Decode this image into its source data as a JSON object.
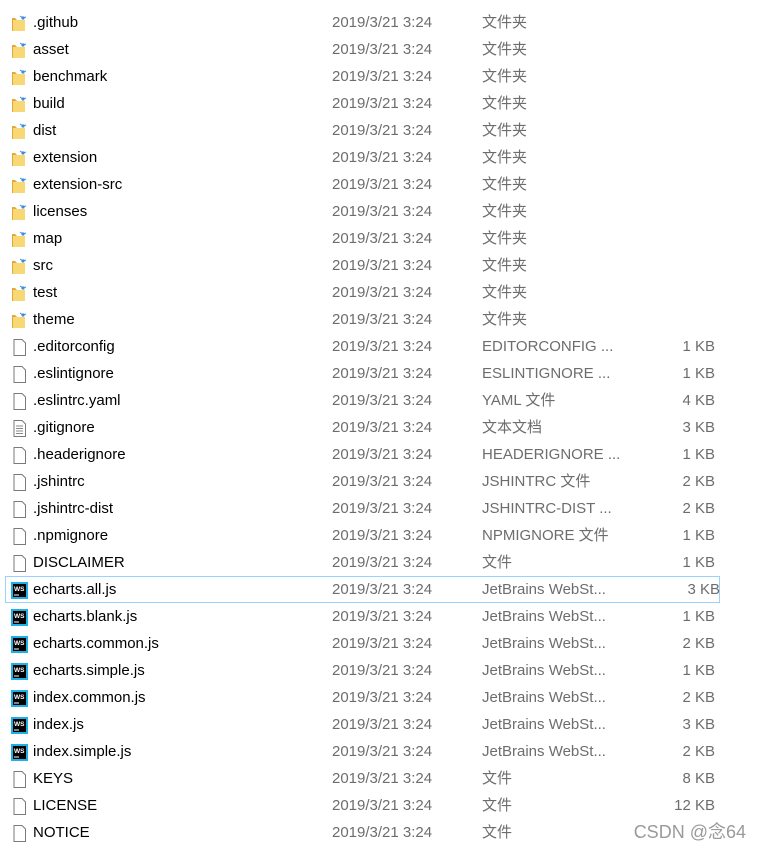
{
  "files": [
    {
      "name": ".github",
      "date": "2019/3/21 3:24",
      "type": "文件夹",
      "size": "",
      "icon": "folder-icon"
    },
    {
      "name": "asset",
      "date": "2019/3/21 3:24",
      "type": "文件夹",
      "size": "",
      "icon": "folder-icon"
    },
    {
      "name": "benchmark",
      "date": "2019/3/21 3:24",
      "type": "文件夹",
      "size": "",
      "icon": "folder-icon"
    },
    {
      "name": "build",
      "date": "2019/3/21 3:24",
      "type": "文件夹",
      "size": "",
      "icon": "folder-icon"
    },
    {
      "name": "dist",
      "date": "2019/3/21 3:24",
      "type": "文件夹",
      "size": "",
      "icon": "folder-icon"
    },
    {
      "name": "extension",
      "date": "2019/3/21 3:24",
      "type": "文件夹",
      "size": "",
      "icon": "folder-icon"
    },
    {
      "name": "extension-src",
      "date": "2019/3/21 3:24",
      "type": "文件夹",
      "size": "",
      "icon": "folder-icon"
    },
    {
      "name": "licenses",
      "date": "2019/3/21 3:24",
      "type": "文件夹",
      "size": "",
      "icon": "folder-icon"
    },
    {
      "name": "map",
      "date": "2019/3/21 3:24",
      "type": "文件夹",
      "size": "",
      "icon": "folder-icon"
    },
    {
      "name": "src",
      "date": "2019/3/21 3:24",
      "type": "文件夹",
      "size": "",
      "icon": "folder-icon"
    },
    {
      "name": "test",
      "date": "2019/3/21 3:24",
      "type": "文件夹",
      "size": "",
      "icon": "folder-icon"
    },
    {
      "name": "theme",
      "date": "2019/3/21 3:24",
      "type": "文件夹",
      "size": "",
      "icon": "folder-icon"
    },
    {
      "name": ".editorconfig",
      "date": "2019/3/21 3:24",
      "type": "EDITORCONFIG ...",
      "size": "1 KB",
      "icon": "file-icon"
    },
    {
      "name": ".eslintignore",
      "date": "2019/3/21 3:24",
      "type": "ESLINTIGNORE ...",
      "size": "1 KB",
      "icon": "file-icon"
    },
    {
      "name": ".eslintrc.yaml",
      "date": "2019/3/21 3:24",
      "type": "YAML 文件",
      "size": "4 KB",
      "icon": "file-icon"
    },
    {
      "name": ".gitignore",
      "date": "2019/3/21 3:24",
      "type": "文本文档",
      "size": "3 KB",
      "icon": "text-file-icon"
    },
    {
      "name": ".headerignore",
      "date": "2019/3/21 3:24",
      "type": "HEADERIGNORE ...",
      "size": "1 KB",
      "icon": "file-icon"
    },
    {
      "name": ".jshintrc",
      "date": "2019/3/21 3:24",
      "type": "JSHINTRC 文件",
      "size": "2 KB",
      "icon": "file-icon"
    },
    {
      "name": ".jshintrc-dist",
      "date": "2019/3/21 3:24",
      "type": "JSHINTRC-DIST ...",
      "size": "2 KB",
      "icon": "file-icon"
    },
    {
      "name": ".npmignore",
      "date": "2019/3/21 3:24",
      "type": "NPMIGNORE 文件",
      "size": "1 KB",
      "icon": "file-icon"
    },
    {
      "name": "DISCLAIMER",
      "date": "2019/3/21 3:24",
      "type": "文件",
      "size": "1 KB",
      "icon": "file-icon"
    },
    {
      "name": "echarts.all.js",
      "date": "2019/3/21 3:24",
      "type": "JetBrains WebSt...",
      "size": "3 KB",
      "icon": "webstorm-icon",
      "selected": true
    },
    {
      "name": "echarts.blank.js",
      "date": "2019/3/21 3:24",
      "type": "JetBrains WebSt...",
      "size": "1 KB",
      "icon": "webstorm-icon"
    },
    {
      "name": "echarts.common.js",
      "date": "2019/3/21 3:24",
      "type": "JetBrains WebSt...",
      "size": "2 KB",
      "icon": "webstorm-icon"
    },
    {
      "name": "echarts.simple.js",
      "date": "2019/3/21 3:24",
      "type": "JetBrains WebSt...",
      "size": "1 KB",
      "icon": "webstorm-icon"
    },
    {
      "name": "index.common.js",
      "date": "2019/3/21 3:24",
      "type": "JetBrains WebSt...",
      "size": "2 KB",
      "icon": "webstorm-icon"
    },
    {
      "name": "index.js",
      "date": "2019/3/21 3:24",
      "type": "JetBrains WebSt...",
      "size": "3 KB",
      "icon": "webstorm-icon"
    },
    {
      "name": "index.simple.js",
      "date": "2019/3/21 3:24",
      "type": "JetBrains WebSt...",
      "size": "2 KB",
      "icon": "webstorm-icon"
    },
    {
      "name": "KEYS",
      "date": "2019/3/21 3:24",
      "type": "文件",
      "size": "8 KB",
      "icon": "file-icon"
    },
    {
      "name": "LICENSE",
      "date": "2019/3/21 3:24",
      "type": "文件",
      "size": "12 KB",
      "icon": "file-icon"
    },
    {
      "name": "NOTICE",
      "date": "2019/3/21 3:24",
      "type": "文件",
      "size": "",
      "icon": "file-icon"
    }
  ],
  "watermark": "CSDN @念64",
  "colors": {
    "selection_border": "#99d1ff",
    "folder": "#f5c85a",
    "webstorm": "#1f8fd8"
  }
}
